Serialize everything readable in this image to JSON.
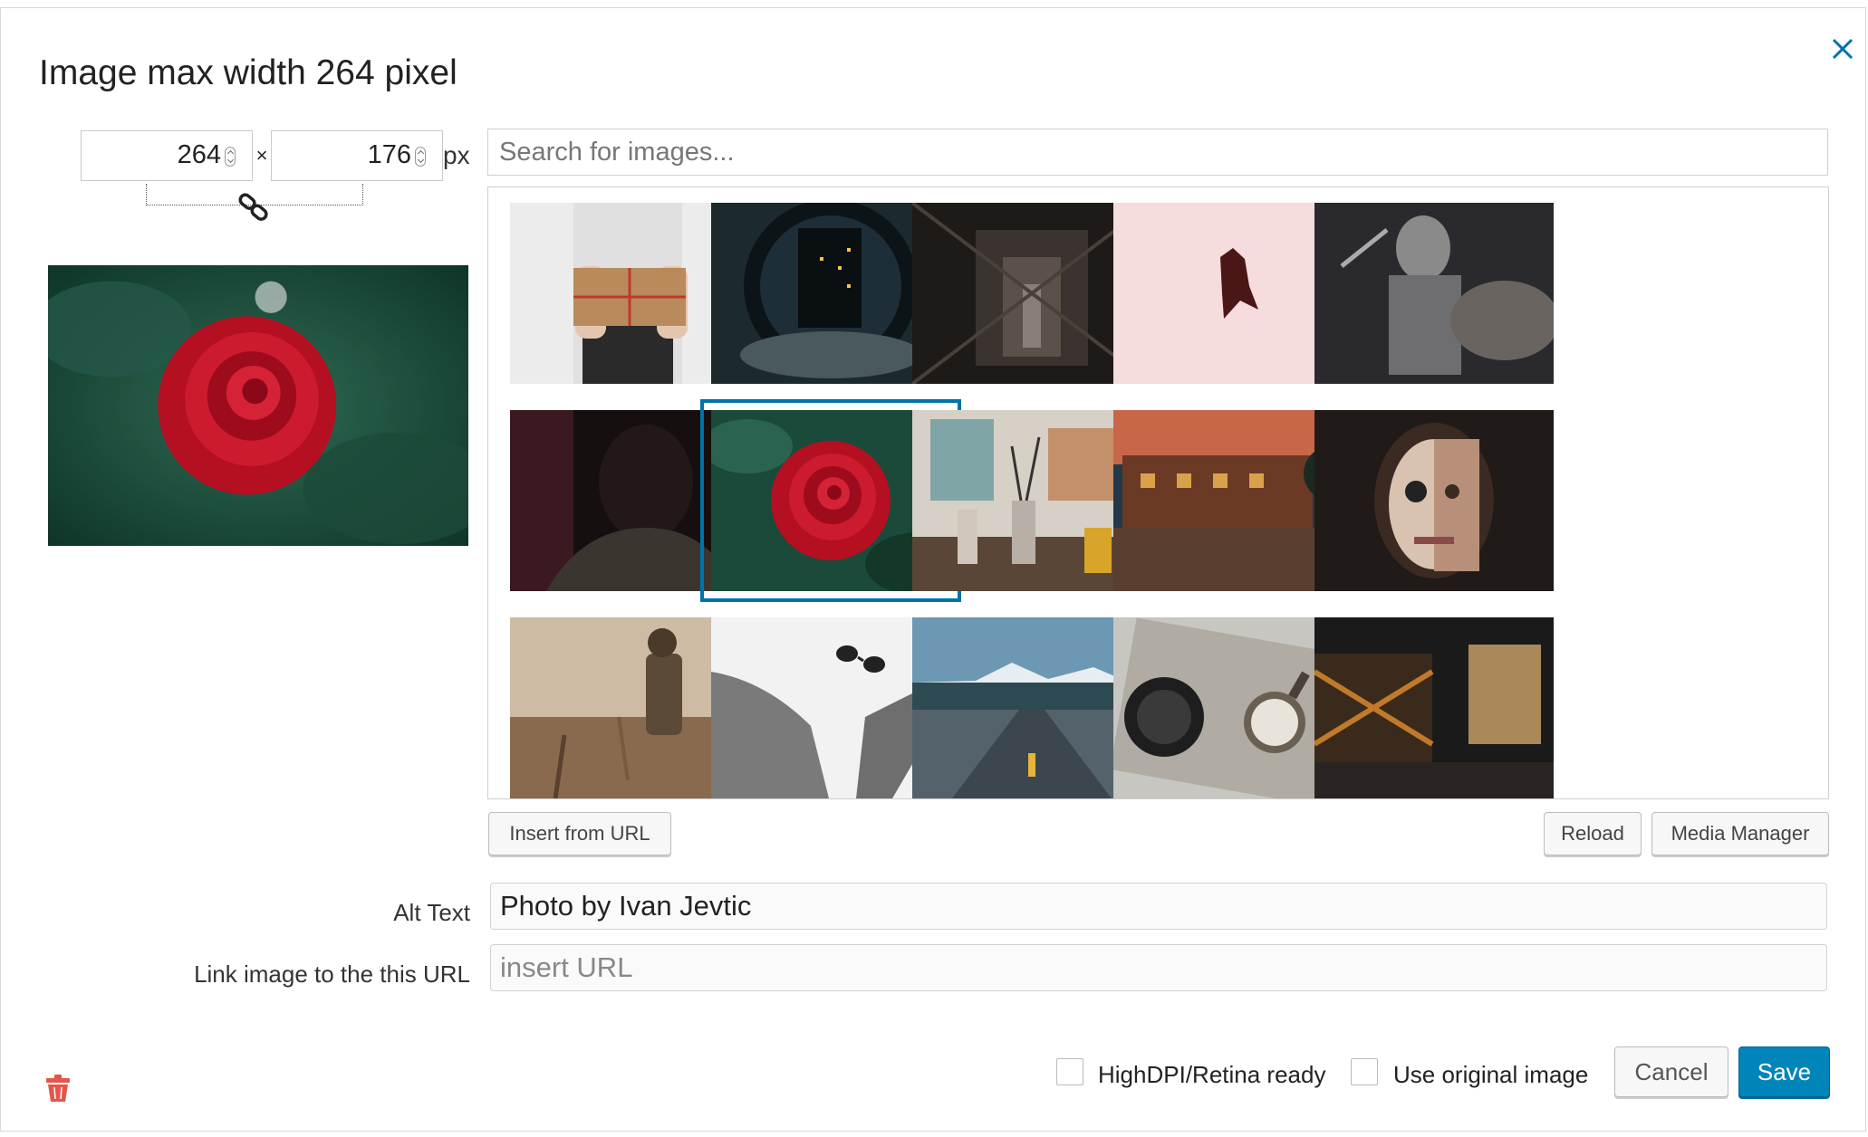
{
  "dialog": {
    "title": "Image max width 264 pixel",
    "close_icon": "close-icon"
  },
  "size": {
    "width": "264",
    "height": "176",
    "separator": "×",
    "unit": "px",
    "link_icon": "chain-link-icon"
  },
  "search": {
    "placeholder": "Search for images..."
  },
  "thumbnails": [
    {
      "subject": "gift box held by person"
    },
    {
      "subject": "night buildings through round window"
    },
    {
      "subject": "dark industrial staircase"
    },
    {
      "subject": "bat on pink background"
    },
    {
      "subject": "knight in armor"
    },
    {
      "subject": "man in shadow"
    },
    {
      "subject": "red rose",
      "selected": true
    },
    {
      "subject": "paint brushes in jars"
    },
    {
      "subject": "abandoned brick building at sunset"
    },
    {
      "subject": "woman with sugar skull makeup"
    },
    {
      "subject": "toy soldier on sand"
    },
    {
      "subject": "grey sweater and sunglasses"
    },
    {
      "subject": "road toward mountains"
    },
    {
      "subject": "compass on map"
    },
    {
      "subject": "industrial factory interior"
    }
  ],
  "buttons": {
    "insert_from_url": "Insert from URL",
    "reload": "Reload",
    "media_manager": "Media Manager",
    "cancel": "Cancel",
    "save": "Save"
  },
  "fields": {
    "alt_label": "Alt Text",
    "alt_value": "Photo by Ivan Jevtic",
    "link_label": "Link image to the this URL",
    "link_placeholder": "insert URL"
  },
  "options": {
    "hidpi_label": "HighDPI/Retina ready",
    "hidpi_checked": false,
    "original_label": "Use original image",
    "original_checked": false
  },
  "colors": {
    "accent": "#0073aa",
    "save_bg": "#0085ba",
    "trash": "#e2574c"
  },
  "trash_icon": "trash-icon"
}
